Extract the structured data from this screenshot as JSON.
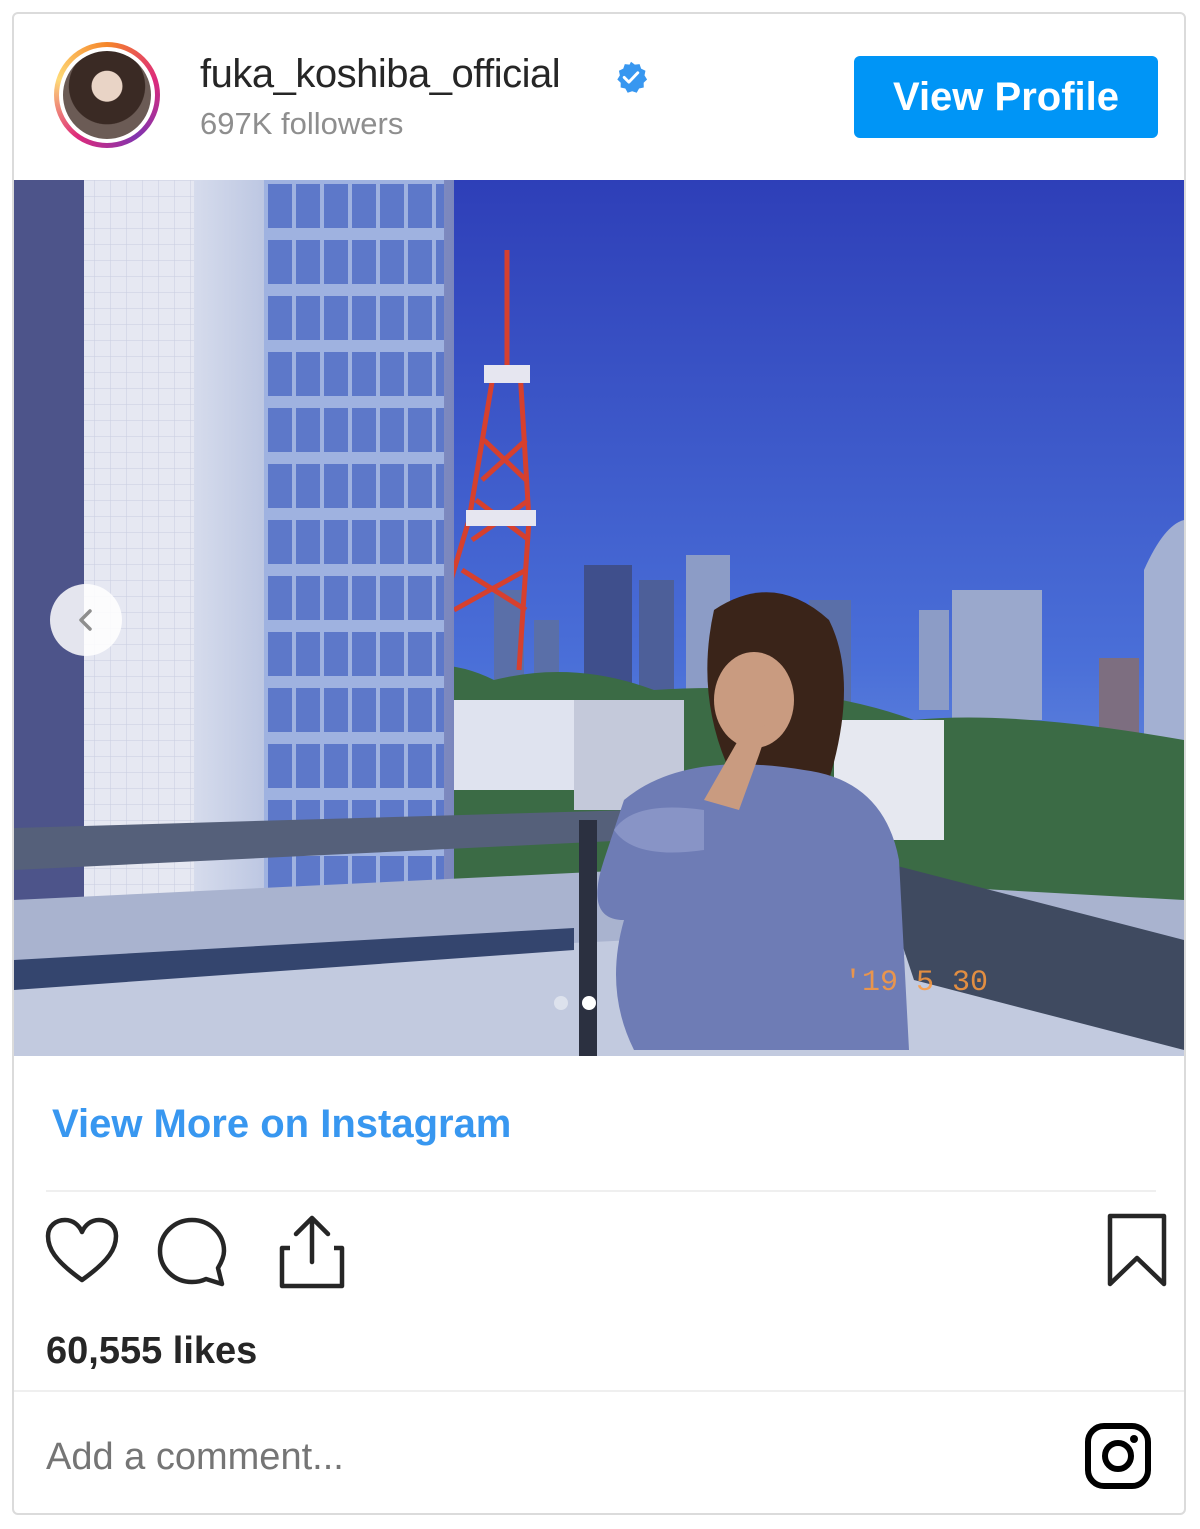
{
  "profile": {
    "username": "fuka_koshiba_official",
    "followers": "697K followers",
    "verified": true,
    "view_profile_label": "View Profile"
  },
  "photo": {
    "carousel_total": 2,
    "carousel_active": 2,
    "date_stamp": "'19 5 30"
  },
  "view_more_label": "View More on Instagram",
  "likes": "60,555 likes",
  "comment": {
    "placeholder": "Add a comment..."
  },
  "icons": {
    "like": "heart-icon",
    "comment": "comment-bubble-icon",
    "share": "share-icon",
    "save": "bookmark-icon",
    "brand": "instagram-logo-icon",
    "prev": "chevron-left-icon",
    "verified": "verified-badge-icon"
  },
  "colors": {
    "button_blue": "#0095f6",
    "link_blue": "#3897f0",
    "text_dark": "#262626",
    "text_muted": "#8e8e8e"
  }
}
